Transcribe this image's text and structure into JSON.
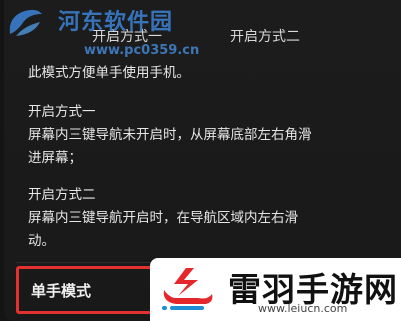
{
  "tabs": [
    "开启方式一",
    "开启方式二"
  ],
  "intro": "此模式方便单手使用手机。",
  "method_one": {
    "title": "开启方式一",
    "body_line1": "屏幕内三键导航未开启时，从屏幕底部左右角滑",
    "body_line2": "进屏幕；"
  },
  "method_two": {
    "title": "开启方式二",
    "body_line1": "屏幕内三键导航开启时，在导航区域内左右滑",
    "body_line2": "动。"
  },
  "setting": {
    "label": "单手模式",
    "highlight_color": "#e2312f"
  },
  "watermark": {
    "text": "河东软件园",
    "url": "www.pc0359.cn",
    "color": "#3c82d7"
  },
  "badge": {
    "title": "雷羽手游网",
    "url": "www.leiucn.com",
    "logo_color": "#e5262b"
  }
}
